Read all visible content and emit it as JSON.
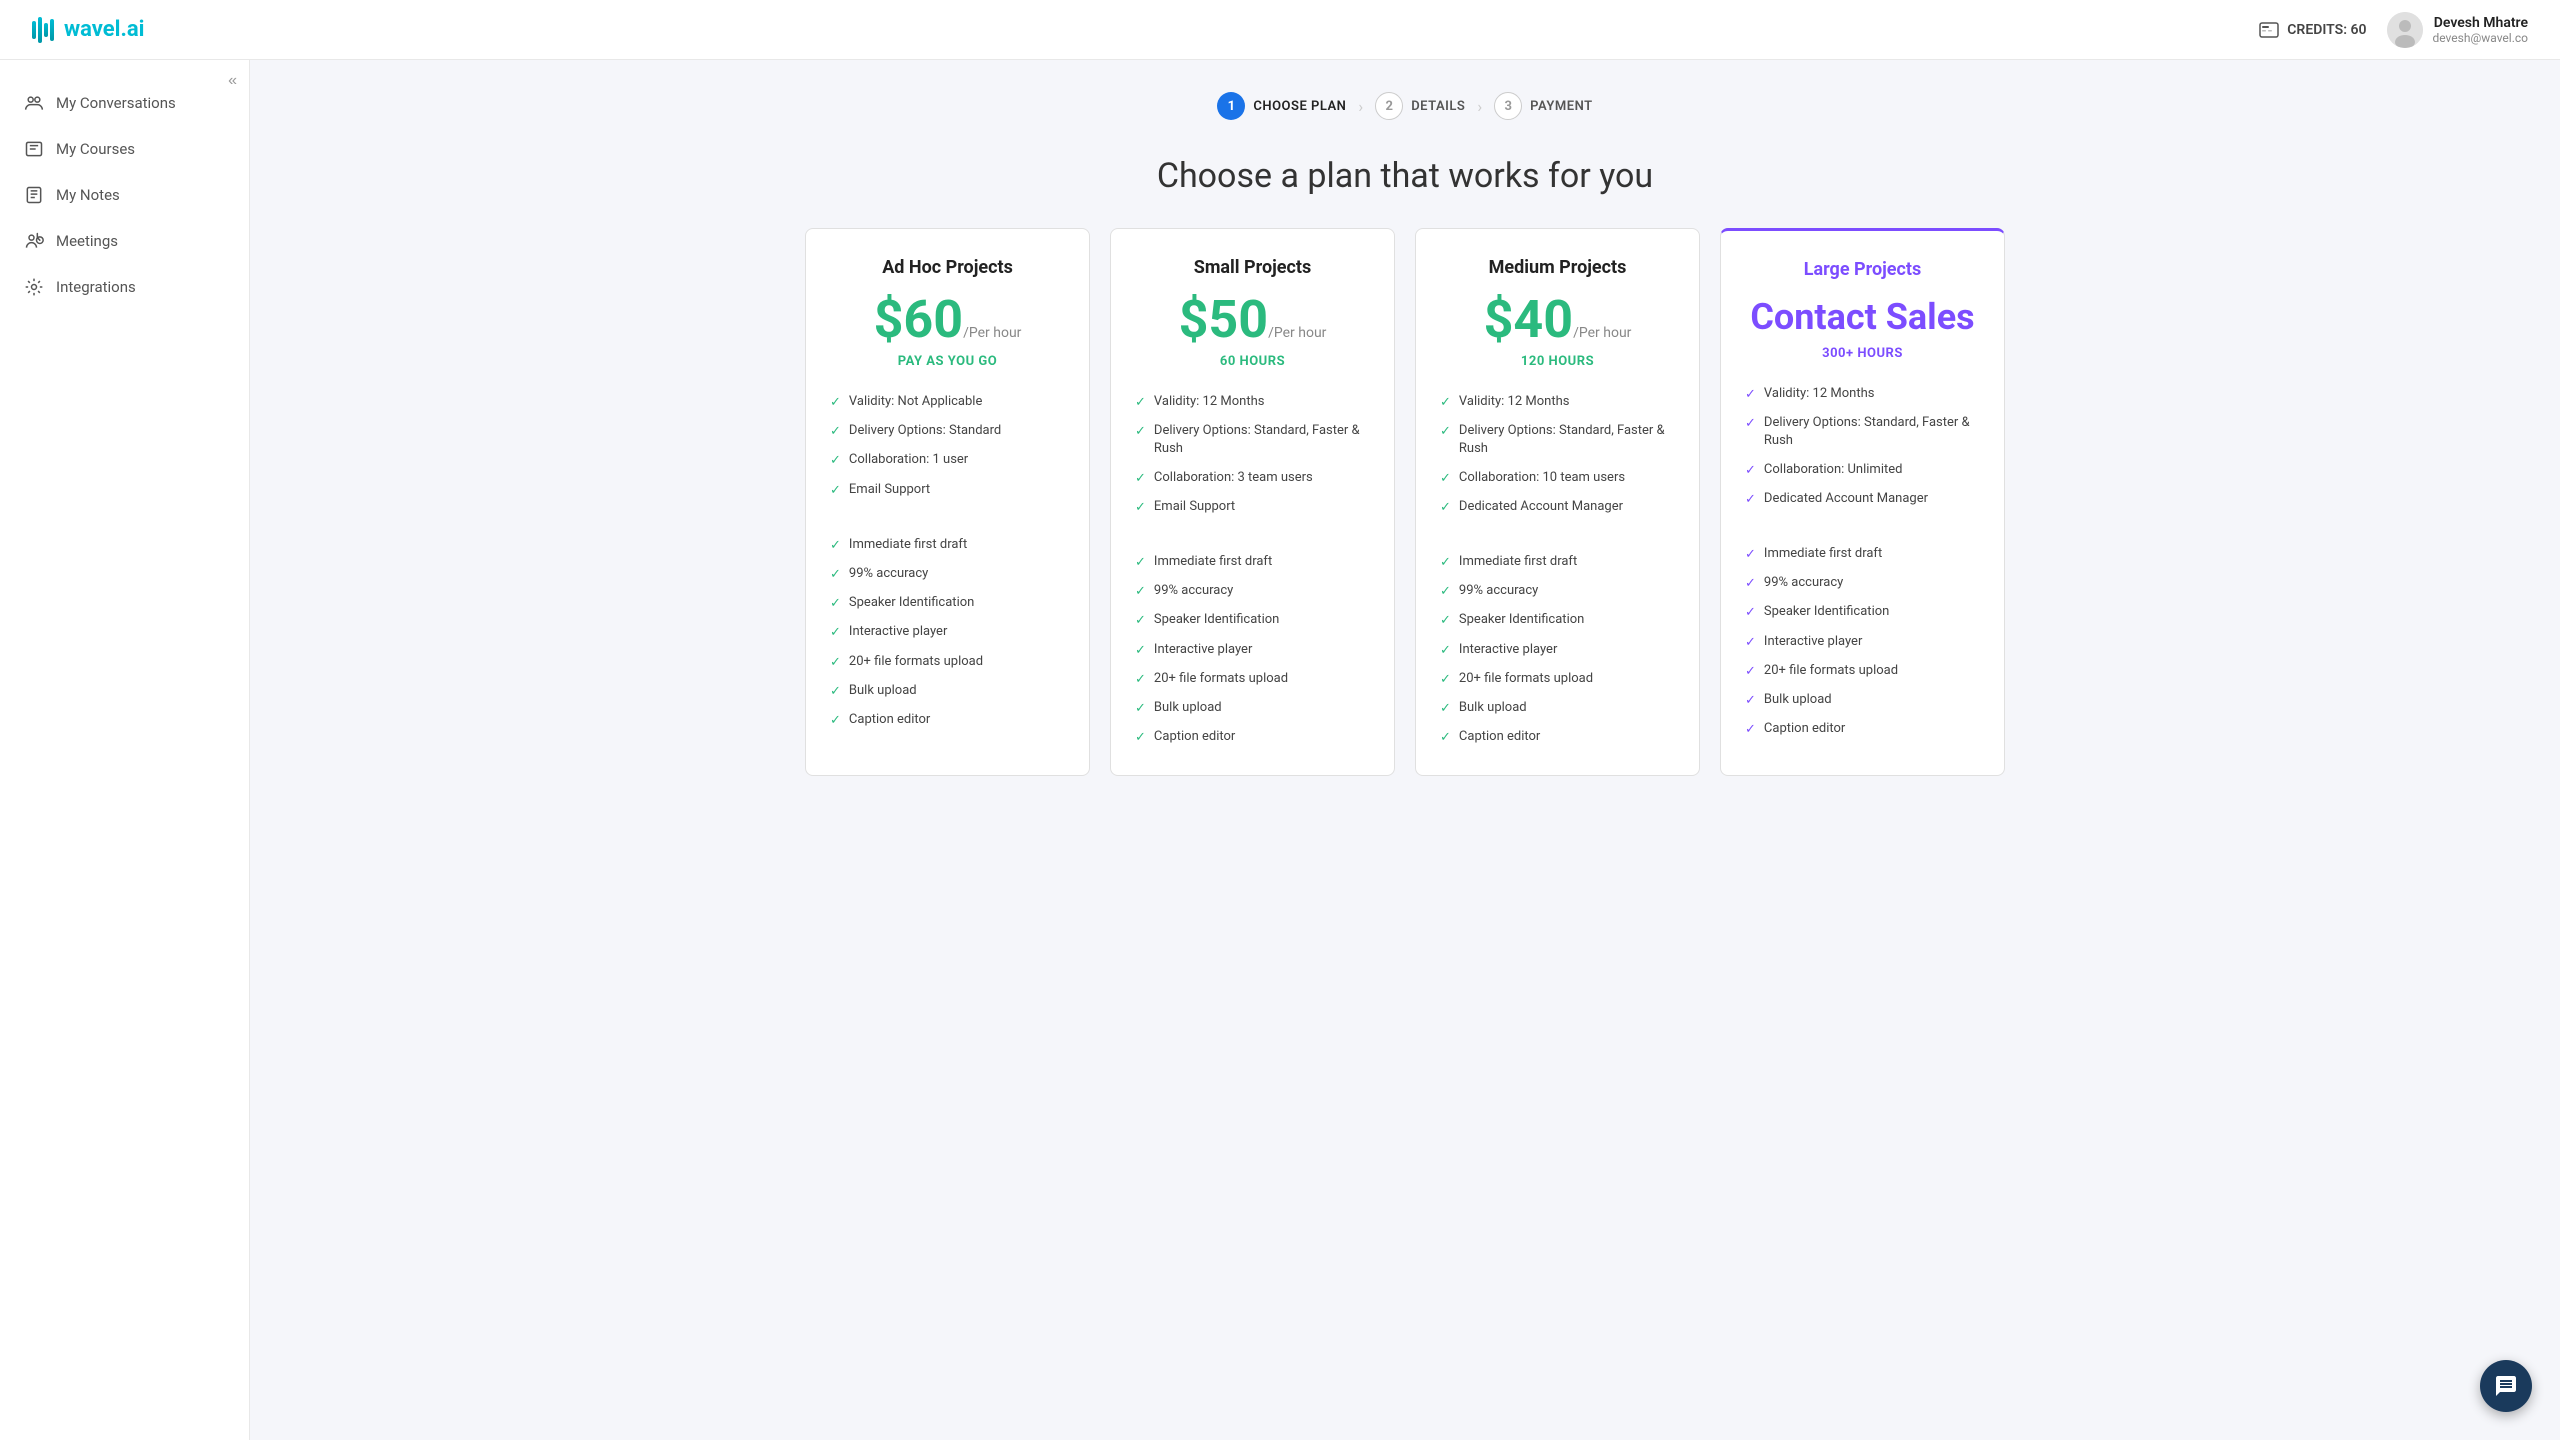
{
  "header": {
    "logo_text": "wavel",
    "logo_suffix": ".ai",
    "credits_label": "CREDITS: 60",
    "user_name": "Devesh Mhatre",
    "user_email": "devesh@wavel.co"
  },
  "sidebar": {
    "collapse_title": "Collapse",
    "items": [
      {
        "id": "conversations",
        "label": "My Conversations",
        "icon": "conversations-icon"
      },
      {
        "id": "courses",
        "label": "My Courses",
        "icon": "courses-icon"
      },
      {
        "id": "notes",
        "label": "My Notes",
        "icon": "notes-icon"
      },
      {
        "id": "meetings",
        "label": "Meetings",
        "icon": "meetings-icon"
      },
      {
        "id": "integrations",
        "label": "Integrations",
        "icon": "integrations-icon"
      }
    ]
  },
  "stepper": {
    "steps": [
      {
        "num": "1",
        "label": "CHOOSE PLAN",
        "active": true
      },
      {
        "num": "2",
        "label": "DETAILS",
        "active": false
      },
      {
        "num": "3",
        "label": "PAYMENT",
        "active": false
      }
    ]
  },
  "page_title": "Choose a plan that works for you",
  "plans": [
    {
      "id": "ad-hoc",
      "name": "Ad Hoc Projects",
      "featured": false,
      "price": "$60",
      "price_period": "/Per hour",
      "hours": "PAY AS YOU GO",
      "features": [
        "Validity: Not Applicable",
        "Delivery Options: Standard",
        "Collaboration: 1 user",
        "Email Support",
        "",
        "Immediate first draft",
        "99% accuracy",
        "Speaker Identification",
        "Interactive player",
        "20+ file formats upload",
        "Bulk upload",
        "Caption editor"
      ]
    },
    {
      "id": "small",
      "name": "Small Projects",
      "featured": false,
      "price": "$50",
      "price_period": "/Per hour",
      "hours": "60 HOURS",
      "features": [
        "Validity: 12 Months",
        "Delivery Options: Standard, Faster & Rush",
        "Collaboration: 3 team users",
        "Email Support",
        "",
        "Immediate first draft",
        "99% accuracy",
        "Speaker Identification",
        "Interactive player",
        "20+ file formats upload",
        "Bulk upload",
        "Caption editor"
      ]
    },
    {
      "id": "medium",
      "name": "Medium Projects",
      "featured": false,
      "price": "$40",
      "price_period": "/Per hour",
      "hours": "120 HOURS",
      "features": [
        "Validity: 12 Months",
        "Delivery Options: Standard, Faster & Rush",
        "Collaboration: 10 team users",
        "Dedicated Account Manager",
        "",
        "Immediate first draft",
        "99% accuracy",
        "Speaker Identification",
        "Interactive player",
        "20+ file formats upload",
        "Bulk upload",
        "Caption editor"
      ]
    },
    {
      "id": "large",
      "name": "Large Projects",
      "featured": true,
      "price": "Contact Sales",
      "price_period": "",
      "hours": "300+ HOURS",
      "features": [
        "Validity: 12 Months",
        "Delivery Options: Standard, Faster & Rush",
        "Collaboration: Unlimited",
        "Dedicated Account Manager",
        "",
        "Immediate first draft",
        "99% accuracy",
        "Speaker Identification",
        "Interactive player",
        "20+ file formats upload",
        "Bulk upload",
        "Caption editor"
      ]
    }
  ]
}
